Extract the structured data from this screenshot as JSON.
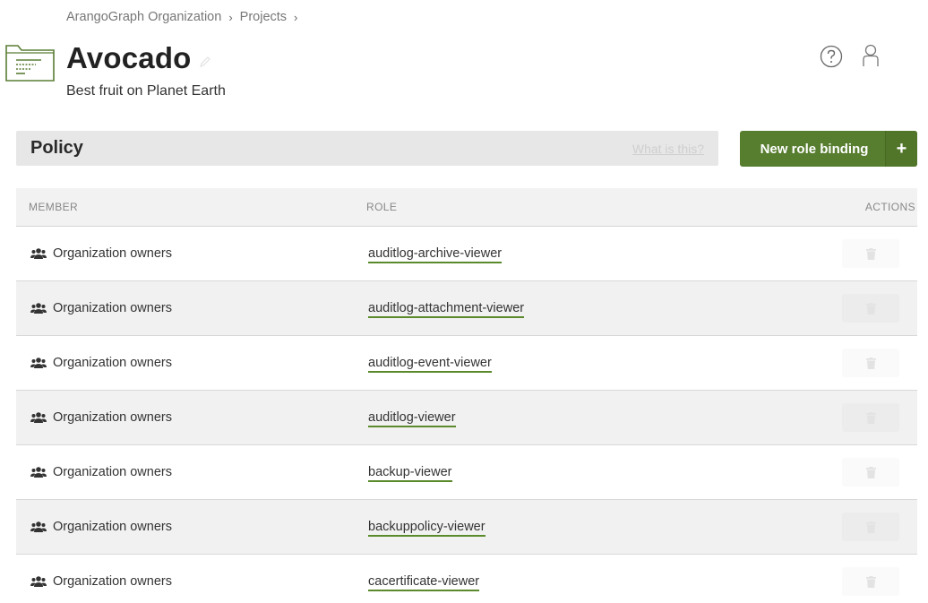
{
  "breadcrumb": {
    "items": [
      "ArangoGraph Organization",
      "Projects"
    ]
  },
  "project": {
    "name": "Avocado",
    "description": "Best fruit on Planet Earth"
  },
  "policy": {
    "title": "Policy",
    "help_link": "What is this?"
  },
  "new_button": {
    "label": "New role binding",
    "plus": "+"
  },
  "table": {
    "headers": {
      "member": "MEMBER",
      "role": "ROLE",
      "actions": "ACTIONS"
    },
    "rows": [
      {
        "member": "Organization owners",
        "role": "auditlog-archive-viewer"
      },
      {
        "member": "Organization owners",
        "role": "auditlog-attachment-viewer"
      },
      {
        "member": "Organization owners",
        "role": "auditlog-event-viewer"
      },
      {
        "member": "Organization owners",
        "role": "auditlog-viewer"
      },
      {
        "member": "Organization owners",
        "role": "backup-viewer"
      },
      {
        "member": "Organization owners",
        "role": "backuppolicy-viewer"
      },
      {
        "member": "Organization owners",
        "role": "cacertificate-viewer"
      }
    ]
  },
  "icons": {
    "folder": "folder-icon",
    "edit": "pencil-icon",
    "help": "help-icon",
    "user": "user-icon",
    "group": "group-icon",
    "delete": "trash-icon"
  },
  "colors": {
    "accent": "#577d2e",
    "link_underline": "#5a8a2b",
    "policy_bar": "#e7e7e7"
  }
}
